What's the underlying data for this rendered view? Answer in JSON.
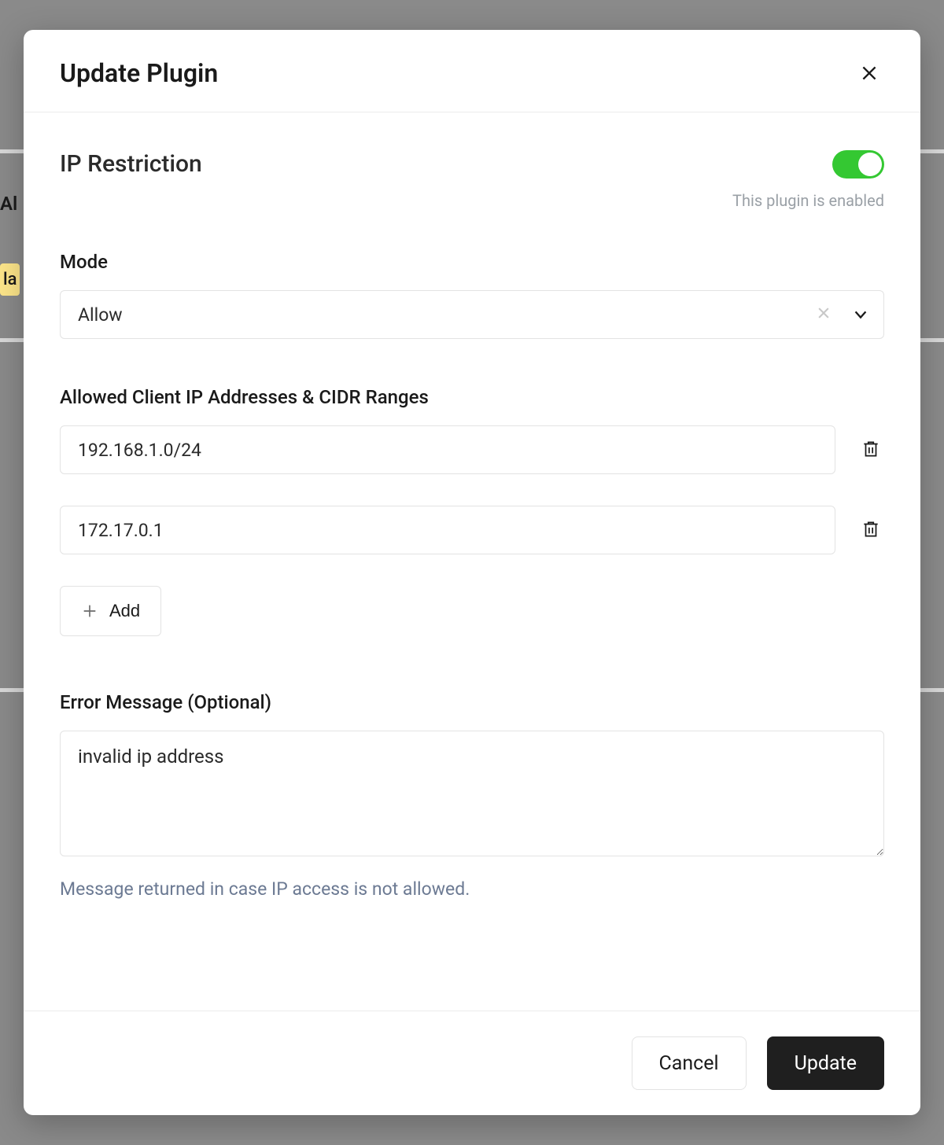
{
  "background": {
    "hint1": "Al",
    "hint2": "la"
  },
  "modal": {
    "title": "Update Plugin"
  },
  "plugin": {
    "name": "IP Restriction",
    "enabled_caption": "This plugin is enabled"
  },
  "mode": {
    "label": "Mode",
    "value": "Allow"
  },
  "allowed": {
    "label": "Allowed Client IP Addresses & CIDR Ranges",
    "entries": [
      "192.168.1.0/24",
      "172.17.0.1"
    ],
    "add_label": "Add"
  },
  "error": {
    "label": "Error Message (Optional)",
    "value": "invalid ip address",
    "help": "Message returned in case IP access is not allowed."
  },
  "footer": {
    "cancel": "Cancel",
    "submit": "Update"
  }
}
